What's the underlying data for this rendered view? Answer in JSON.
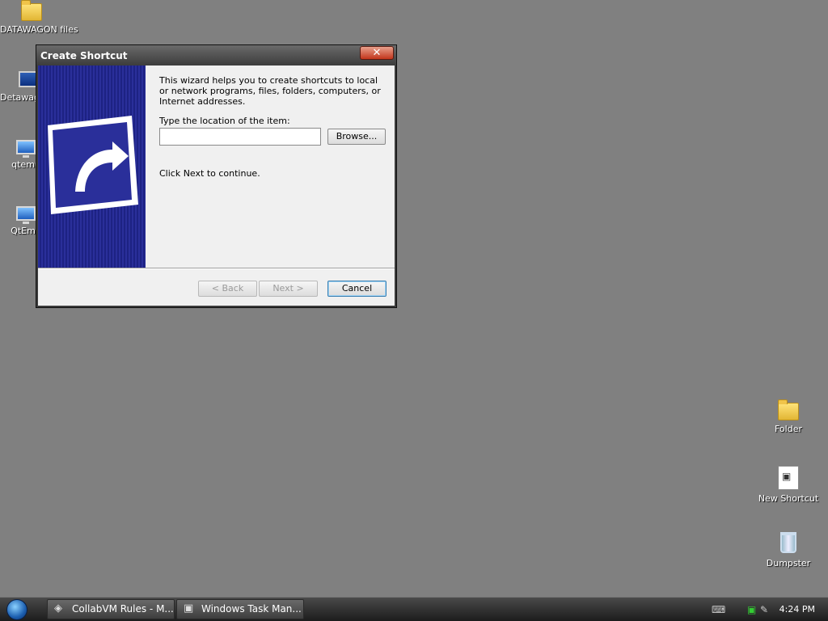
{
  "desktop_icons": [
    {
      "label": "DATAWAGON files",
      "icon": "folder-icon"
    },
    {
      "label": "Detawagon pc",
      "icon": "computer-icon"
    },
    {
      "label": "qtemu",
      "icon": "monitor-icon"
    },
    {
      "label": "QtEmu",
      "icon": "shortcut-icon"
    },
    {
      "label": "Folder",
      "icon": "folder-icon"
    },
    {
      "label": "New Shortcut",
      "icon": "document-icon"
    },
    {
      "label": "Dumpster",
      "icon": "recycle-bin-icon"
    }
  ],
  "dialog": {
    "title": "Create Shortcut",
    "close_label": "✕",
    "intro": "This wizard helps you to create shortcuts to local or network programs, files, folders, computers, or Internet addresses.",
    "location_label": "Type the location of the item:",
    "location_value": "",
    "browse_label": "Browse...",
    "continue_text": "Click Next to continue.",
    "back_label": "< Back",
    "next_label": "Next >",
    "cancel_label": "Cancel"
  },
  "taskbar": {
    "items": [
      {
        "label": "CollabVM Rules - M...",
        "icon": "browser-icon"
      },
      {
        "label": "Windows Task Man...",
        "icon": "task-manager-icon"
      }
    ],
    "clock": "4:24 PM"
  },
  "colors": {
    "desktop": "#808080",
    "banner": "#2a2f9a"
  }
}
